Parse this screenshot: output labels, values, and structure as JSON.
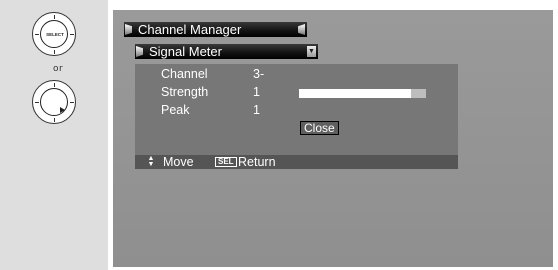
{
  "remote": {
    "select_label": "SELECT",
    "or_label": "or"
  },
  "menu": {
    "title": "Channel Manager",
    "submenu_title": "Signal Meter"
  },
  "signal_meter": {
    "rows": [
      {
        "label": "Channel",
        "value": "3-"
      },
      {
        "label": "Strength",
        "value": "1"
      },
      {
        "label": "Peak",
        "value": "1"
      }
    ],
    "strength_bar_fill_fraction": 0.88,
    "close_label": "Close"
  },
  "footer": {
    "move_label": "Move",
    "sel_key": "SEL",
    "return_label": "Return"
  },
  "colors": {
    "screen_bg": "#9a9a9a",
    "panel_bg": "#777777",
    "bar_bg": "#111111",
    "left_panel_bg": "#dedede"
  }
}
